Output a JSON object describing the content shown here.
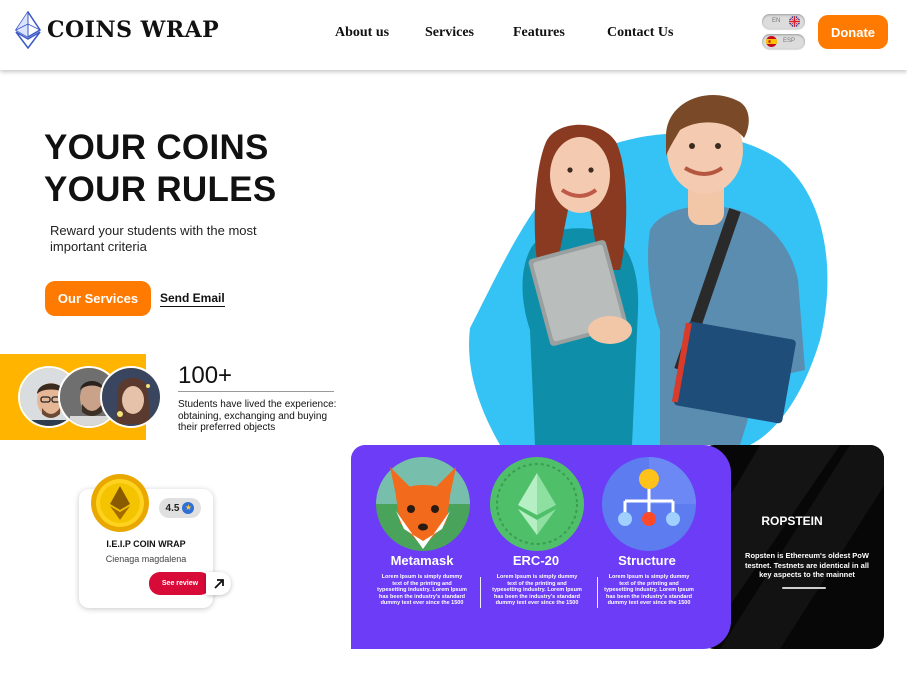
{
  "header": {
    "logo_text": "COINS WRAP",
    "logo_icon": "ethereum-icon",
    "nav": [
      "About us",
      "Services",
      "Features",
      "Contact Us"
    ],
    "languages": [
      {
        "code": "EN",
        "flag": "uk-flag-icon"
      },
      {
        "code": "ESP",
        "flag": "spain-flag-icon"
      }
    ],
    "donate_label": "Donate"
  },
  "hero": {
    "title_line1_bold": "YOUR",
    "title_line1_rest": " COINS",
    "title_line2": "YOUR RULES",
    "subtitle": "Reward your students with the most important criteria",
    "primary_button": "Our Services",
    "secondary_link": "Send Email"
  },
  "stats": {
    "count": "100+",
    "text": "Students have lived the experience: obtaining, exchanging and buying their preferred objects"
  },
  "review_card": {
    "rating": "4.5",
    "title": "I.E.I.P COIN WRAP",
    "location": "Cienaga magdalena",
    "button": "See review"
  },
  "features": [
    {
      "name": "Metamask",
      "icon": "fox-icon",
      "desc": "Lorem Ipsum is simply dummy text of the printing and typesetting industry. Lorem Ipsum has been the industry's standard dummy text ever since the 1500"
    },
    {
      "name": "ERC-20",
      "icon": "ethereum-token-icon",
      "desc": "Lorem Ipsum is simply dummy text of the printing and typesetting industry. Lorem Ipsum has been the industry's standard dummy text ever since the 1500"
    },
    {
      "name": "Structure",
      "icon": "hierarchy-icon",
      "desc": "Lorem Ipsum is simply dummy text of the printing and typesetting industry. Lorem Ipsum has been the industry's standard dummy text ever since the 1500"
    }
  ],
  "ropstein": {
    "title": "ROPSTEIN",
    "desc": "Ropsten is Ethereum's oldest PoW testnet. Testnets are identical in all key aspects to the mainnet"
  },
  "colors": {
    "accent_orange": "#ff7a00",
    "yellow": "#ffb400",
    "purple": "#6c3cf7",
    "blob_blue": "#35c2f5",
    "review_red": "#d70a38"
  }
}
